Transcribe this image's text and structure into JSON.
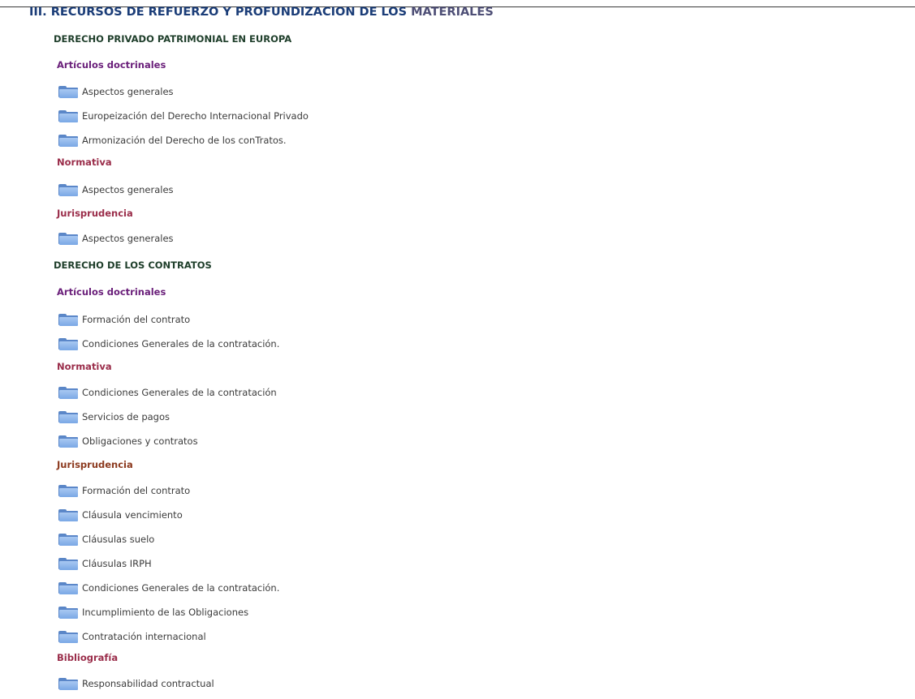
{
  "title": {
    "part1": "III. RECURSOS DE REFUERZO Y PROFUNDIZACION DE LOS ",
    "part2": "MATERIALES"
  },
  "sections": [
    {
      "heading": "DERECHO PRIVADO PATRIMONIAL EN EUROPA",
      "categories": [
        {
          "label": "Artículos doctrinales",
          "items": [
            "Aspectos generales",
            "Europeización del Derecho Internacional Privado",
            "Armonización del Derecho de los conTratos."
          ]
        },
        {
          "label": "Normativa",
          "items": [
            "Aspectos generales"
          ]
        },
        {
          "label": "Jurisprudencia",
          "items": [
            "Aspectos generales"
          ]
        }
      ]
    },
    {
      "heading": "DERECHO DE LOS CONTRATOS",
      "categories": [
        {
          "label": "Artículos doctrinales",
          "items": [
            "Formación del contrato",
            "Condiciones Generales de la contratación."
          ]
        },
        {
          "label": "Normativa",
          "items": [
            "Condiciones Generales de la contratación",
            "Servicios de pagos",
            "Obligaciones y contratos"
          ]
        },
        {
          "label": "Jurisprudencia",
          "items": [
            "Formación del contrato",
            "Cláusula vencimiento",
            "Cláusulas suelo",
            "Cláusulas IRPH",
            "Condiciones Generales de la contratación.",
            "Incumplimiento de las Obligaciones",
            "Contratación internacional"
          ]
        },
        {
          "label": "Bibliografía",
          "items": [
            "Responsabilidad contractual"
          ]
        }
      ]
    }
  ],
  "icons": {
    "item_icon": "folder-icon"
  },
  "colors": {
    "title": "#1b3d78",
    "section_heading": "#1e3e2a",
    "articulos": "#6a1f7a",
    "normativa": "#9a2d4a",
    "item_text": "#3b3b3b",
    "folder": "#7aa7e5"
  }
}
